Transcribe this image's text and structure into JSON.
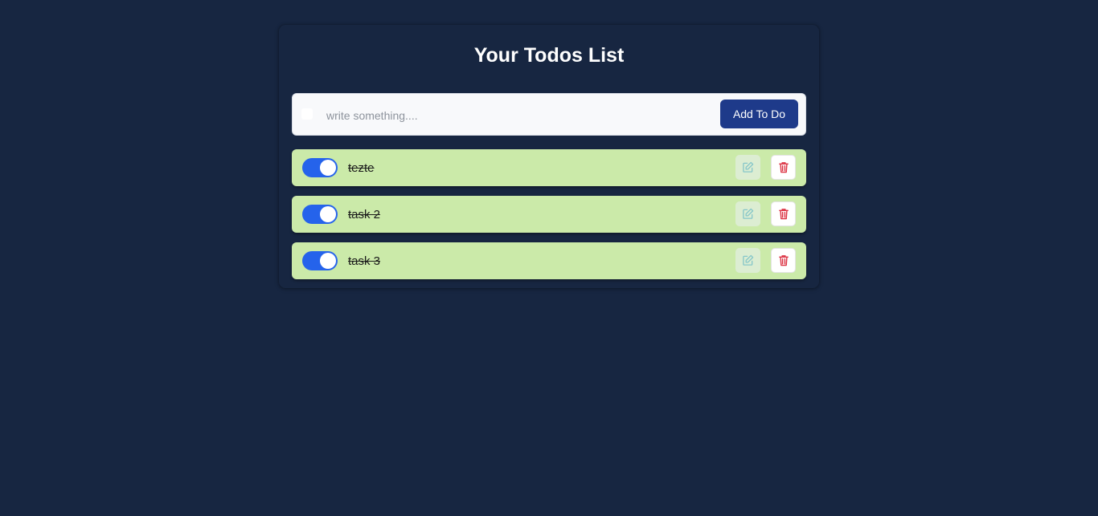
{
  "header": {
    "title": "Your Todos List"
  },
  "add_form": {
    "placeholder": "write something....",
    "value": "",
    "button_label": "Add To Do"
  },
  "todos": [
    {
      "text": "tezte",
      "completed": true
    },
    {
      "text": "task 2",
      "completed": true
    },
    {
      "text": "task 3",
      "completed": true
    }
  ],
  "icons": {
    "edit": "pencil-square-icon",
    "delete": "trash-icon"
  },
  "colors": {
    "page_background": "#172641",
    "todo_background": "#cbeaa9",
    "add_button": "#1e3a8a",
    "toggle_on": "#2563eb",
    "delete_icon": "#dc3545",
    "edit_icon": "#86c6c9"
  }
}
